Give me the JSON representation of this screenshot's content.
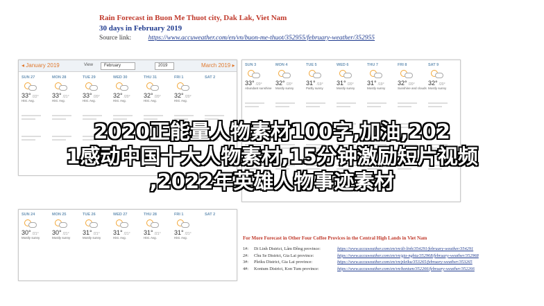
{
  "header": {
    "title": "Rain Forecast in Buon Me Thuot city, Dak Lak, Viet Nam",
    "subtitle": "30 days in February 2019",
    "source_label": "Source link:",
    "source_url": "https://www.accuweather.com/en/vn/buon-me-thuot/352955/february-weather/352955"
  },
  "calendar": {
    "prev_month": "January 2019",
    "view_label": "View",
    "month_select": "February",
    "year_select": "2019",
    "next_month": "March 2019"
  },
  "top_left_days": [
    {
      "d": "SUN 27",
      "t": "33°",
      "lo": "/22°",
      "ds": "Hist. Avg."
    },
    {
      "d": "MON 28",
      "t": "33°",
      "lo": "/21°",
      "ds": "Hist. Avg."
    },
    {
      "d": "TUE 29",
      "t": "33°",
      "lo": "/20°",
      "ds": "Hist. Avg."
    },
    {
      "d": "WED 30",
      "t": "32°",
      "lo": "/20°",
      "ds": "Hist. Avg."
    },
    {
      "d": "THU 31",
      "t": "32°",
      "lo": "/20°",
      "ds": "Hist. Avg."
    },
    {
      "d": "FRI 1",
      "t": "32°",
      "lo": "/20°",
      "ds": "Hist. Avg."
    },
    {
      "d": "SAT 2",
      "t": "",
      "lo": "",
      "ds": ""
    }
  ],
  "top_right_days": [
    {
      "d": "SUN 3",
      "t": "33°",
      "lo": "/20°",
      "ds": "Abundant sunshine"
    },
    {
      "d": "MON 4",
      "t": "32°",
      "lo": "/20°",
      "ds": "Mostly sunny"
    },
    {
      "d": "TUE 5",
      "t": "31°",
      "lo": "/19°",
      "ds": "Partly sunny"
    },
    {
      "d": "WED 6",
      "t": "31°",
      "lo": "/20°",
      "ds": "Mostly sunny"
    },
    {
      "d": "THU 7",
      "t": "31°",
      "lo": "/19°",
      "ds": "Mostly sunny"
    },
    {
      "d": "FRI 8",
      "t": "32°",
      "lo": "/20°",
      "ds": "Sunshine and clouds"
    },
    {
      "d": "SAT 9",
      "t": "32°",
      "lo": "/20°",
      "ds": "Mostly sunny"
    }
  ],
  "bottom_days": [
    {
      "d": "SUN 24",
      "t": "30°",
      "lo": "/21°",
      "ds": "Mostly sunny"
    },
    {
      "d": "MON 25",
      "t": "30°",
      "lo": "/21°",
      "ds": "Mostly sunny"
    },
    {
      "d": "TUE 26",
      "t": "31°",
      "lo": "/21°",
      "ds": "Mostly sunny"
    },
    {
      "d": "WED 27",
      "t": "31°",
      "lo": "/21°",
      "ds": "Hist. Avg."
    },
    {
      "d": "THU 28",
      "t": "31°",
      "lo": "/21°",
      "ds": "Hist. Avg."
    },
    {
      "d": "FRI 1",
      "t": "31°",
      "lo": "/21°",
      "ds": "Hist. Avg."
    },
    {
      "d": "SAT 2",
      "t": "",
      "lo": "",
      "ds": ""
    }
  ],
  "more": {
    "heading": "For More Forecast in Other Four Coffee Provices in the Central High Lands in Viet Nam",
    "rows": [
      {
        "n": "1#:",
        "name": "Di Linh District, Lâm Đồng province:",
        "url": "https://www.accuweather.com/en/vn/di-linh/354291/february-weather/354291"
      },
      {
        "n": "2#:",
        "name": "Chu Se District, Gia Lai province:",
        "url": "https://www.accuweather.com/en/vn/gia-nghia/352968/february-weather/352968"
      },
      {
        "n": "3#:",
        "name": "Pleiku District, Gia Lai province:",
        "url": "https://www.accuweather.com/en/vn/pleiku/353265/february-weather/353265"
      },
      {
        "n": "4#:",
        "name": "Kontum District, Kon Tum province:",
        "url": "https://www.accuweather.com/en/vn/kontum/352266/february-weather/352266"
      }
    ]
  },
  "watermark": {
    "line1": "2020正能量人物素材100字,加油,202",
    "line2": "1感动中国十大人物素材,15分钟激励短片视频",
    "line3": ",2022年英雄人物事迹素材"
  }
}
